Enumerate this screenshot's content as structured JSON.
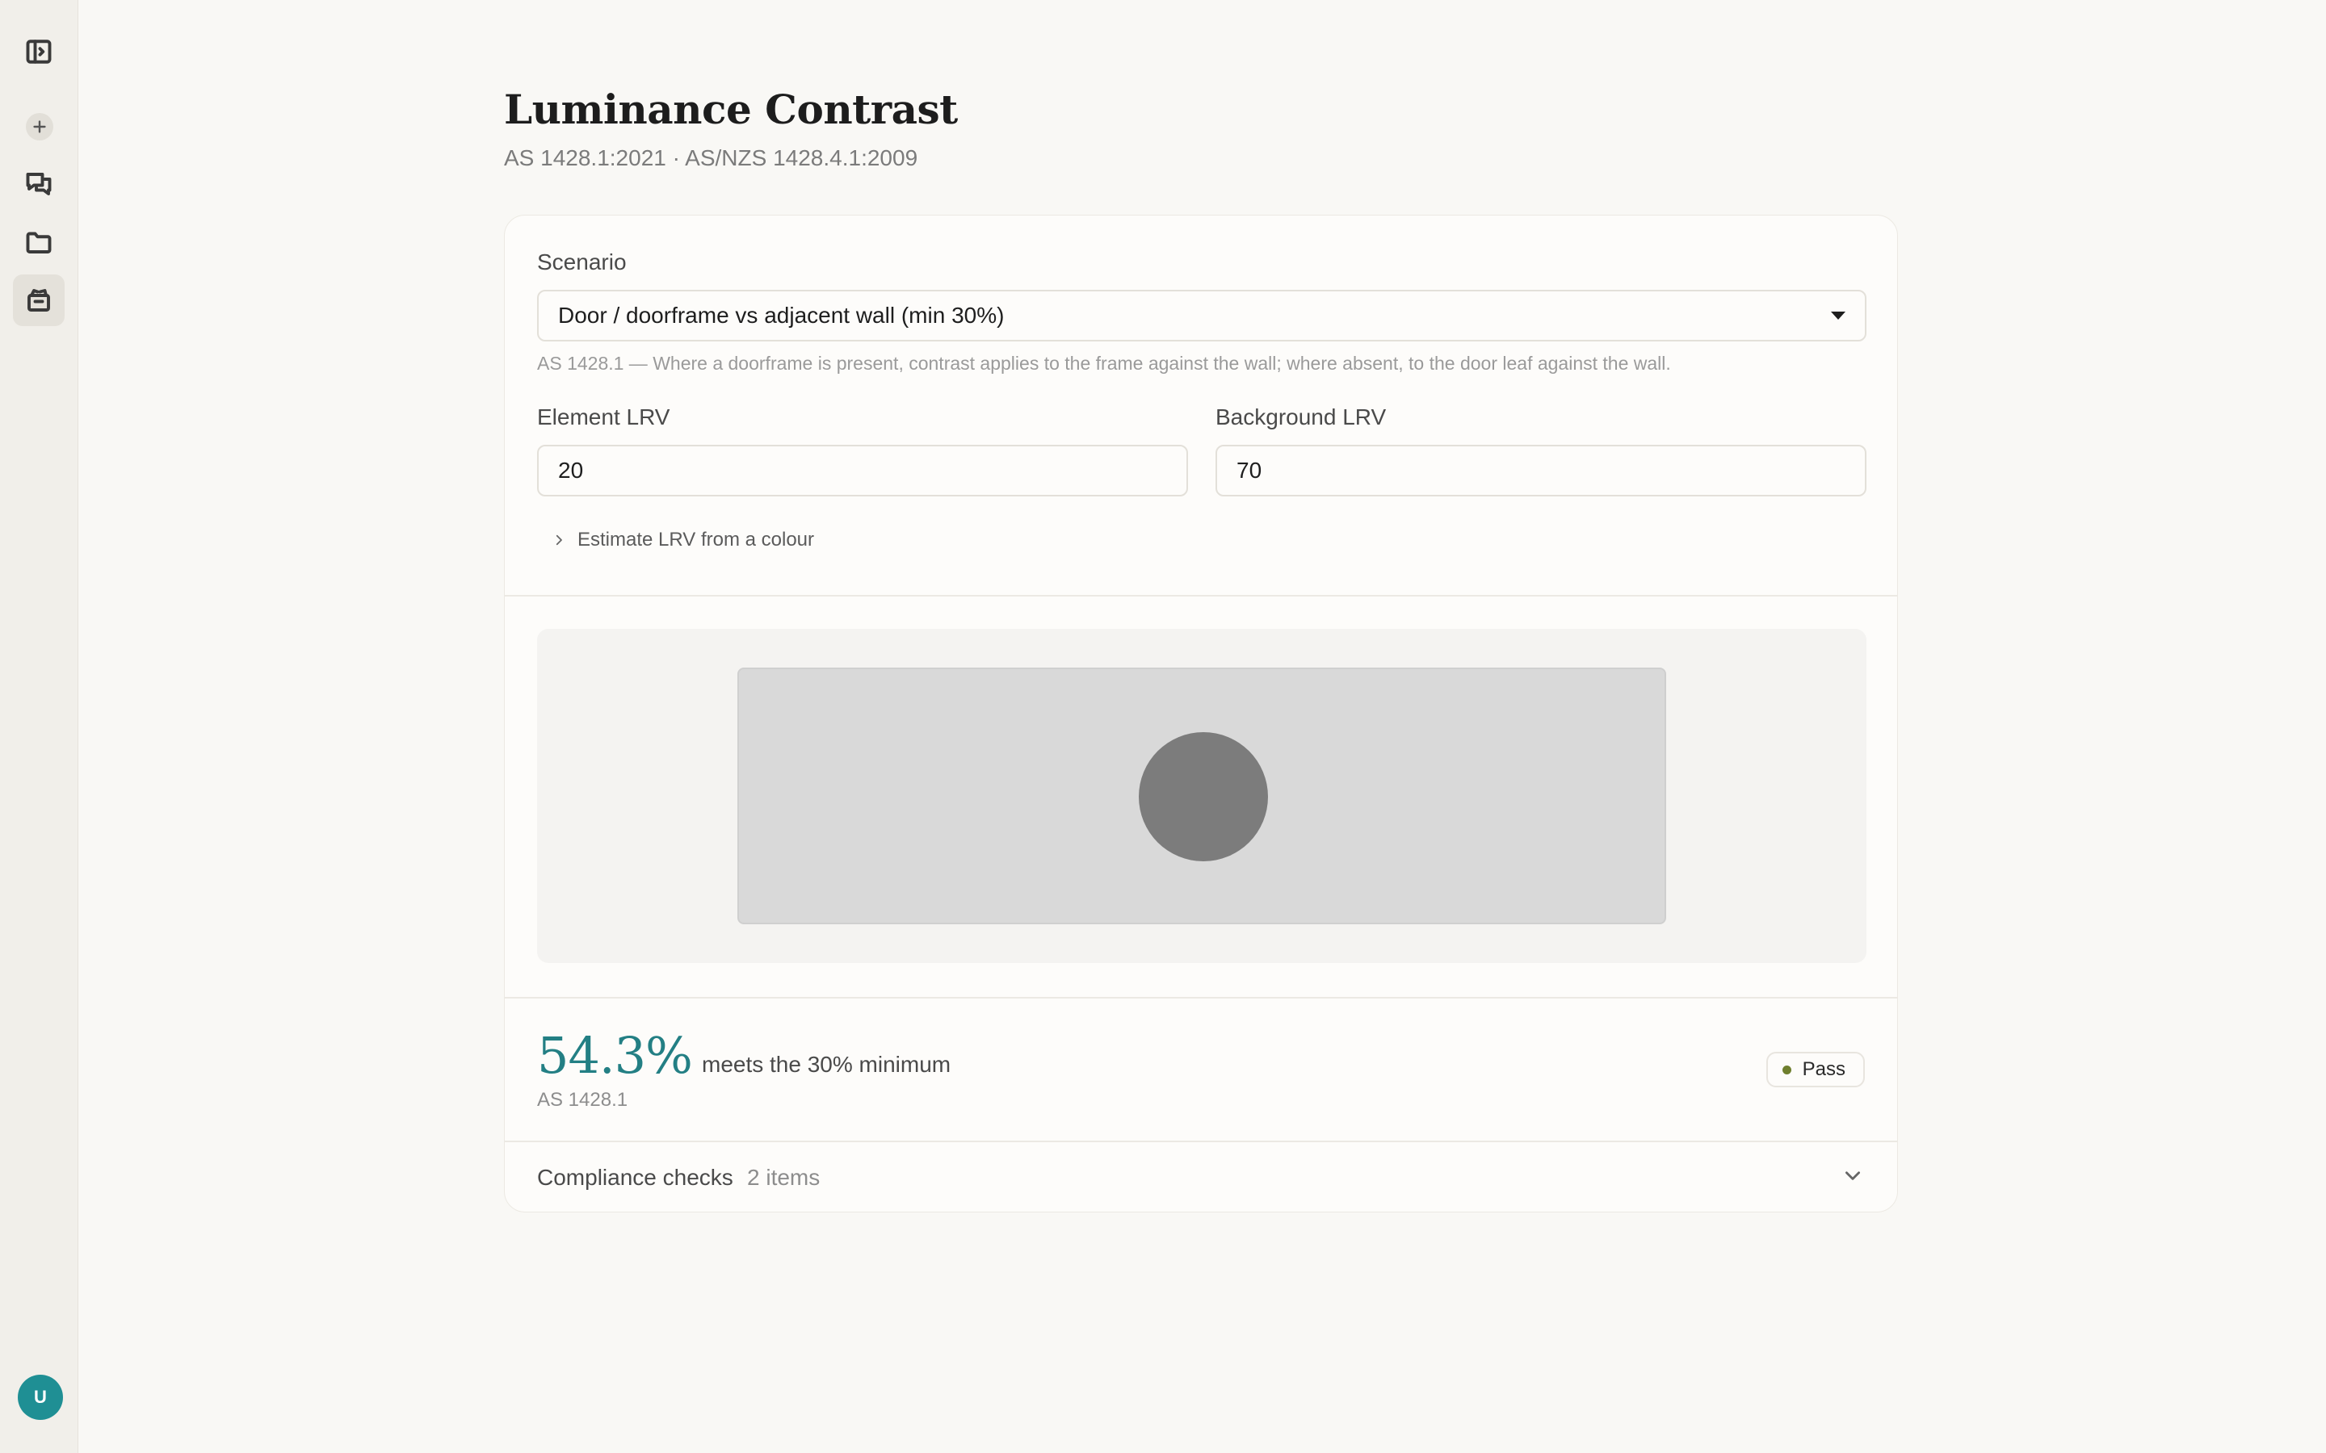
{
  "sidebar": {
    "icons": [
      "sidebar-toggle-icon",
      "plus-icon",
      "chat-icon",
      "folder-icon",
      "tools-icon"
    ],
    "avatar_initial": "U"
  },
  "header": {
    "title": "Luminance Contrast",
    "subtitle": "AS 1428.1:2021 · AS/NZS 1428.4.1:2009"
  },
  "form": {
    "scenario_label": "Scenario",
    "scenario_value": "Door / doorframe vs adjacent wall (min 30%)",
    "scenario_helper": "AS 1428.1 — Where a doorframe is present, contrast applies to the frame against the wall; where absent, to the door leaf against the wall.",
    "element_lrv_label": "Element LRV",
    "element_lrv_value": "20",
    "background_lrv_label": "Background LRV",
    "background_lrv_value": "70",
    "estimate_label": "Estimate LRV from a colour"
  },
  "preview": {
    "background_color": "#d9d9d9",
    "element_color": "#7c7c7c"
  },
  "result": {
    "value": "54.3%",
    "summary": "meets the 30% minimum",
    "standard": "AS 1428.1",
    "status": "Pass",
    "status_color": "#6f7f2e",
    "accent_color": "#237f84"
  },
  "compliance": {
    "label": "Compliance checks",
    "count": "2 items"
  }
}
